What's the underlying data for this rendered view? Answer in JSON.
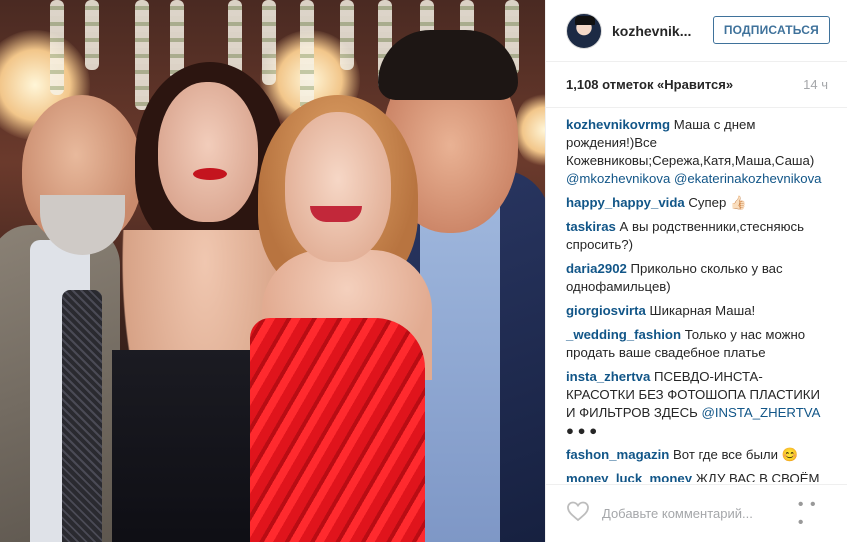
{
  "post": {
    "username": "kozhevnik...",
    "follow_label": "ПОДПИСАТЬСЯ",
    "likes": "1,108 отметок «Нравится»",
    "time_ago": "14 ч"
  },
  "caption": {
    "user": "kozhevnikovrmg",
    "text": "Маша с днем рождения!)Все Кожевниковы;Сережа,Катя,Маша,Саша)",
    "mention1": "@mkozhevnikova",
    "mention2": "@ekaterinakozhevnikova"
  },
  "comments": [
    {
      "user": "happy_happy_vida",
      "text": "Супер 👍🏻"
    },
    {
      "user": "taskiras",
      "text": "А вы родственники,стесняюсь спросить?)"
    },
    {
      "user": "daria2902",
      "text": "Прикольно сколько у вас однофамильцев)"
    },
    {
      "user": "giorgiosvirta",
      "text": "Шикарная Маша!"
    },
    {
      "user": "_wedding_fashion",
      "text": "Только у нас можно продать ваше свадебное платье"
    },
    {
      "user": "insta_zhertva",
      "text": "ПСЕВДО-ИНСТА-КРАСОТКИ БЕЗ ФОТОШОПА ПЛАСТИКИ И ФИЛЬТРОВ ЗДЕСЬ",
      "mention": "@INSTA_ZHERTVA",
      "suffix": " ● ● ●"
    },
    {
      "user": "fashon_magazin",
      "text": "Вот где все были 😊"
    },
    {
      "user": "money_luck_money",
      "text": "ЖДУ ВАС В СВОЁМ ПРОФИЛЕ!"
    }
  ],
  "add_comment": {
    "placeholder": "Добавьте комментарий...",
    "more": "• • •"
  },
  "icons": {
    "heart": "heart-icon",
    "more": "more-options-icon",
    "avatar": "avatar"
  },
  "colors": {
    "link": "#125688",
    "follow": "#3f729b",
    "muted": "#a5a7aa"
  }
}
